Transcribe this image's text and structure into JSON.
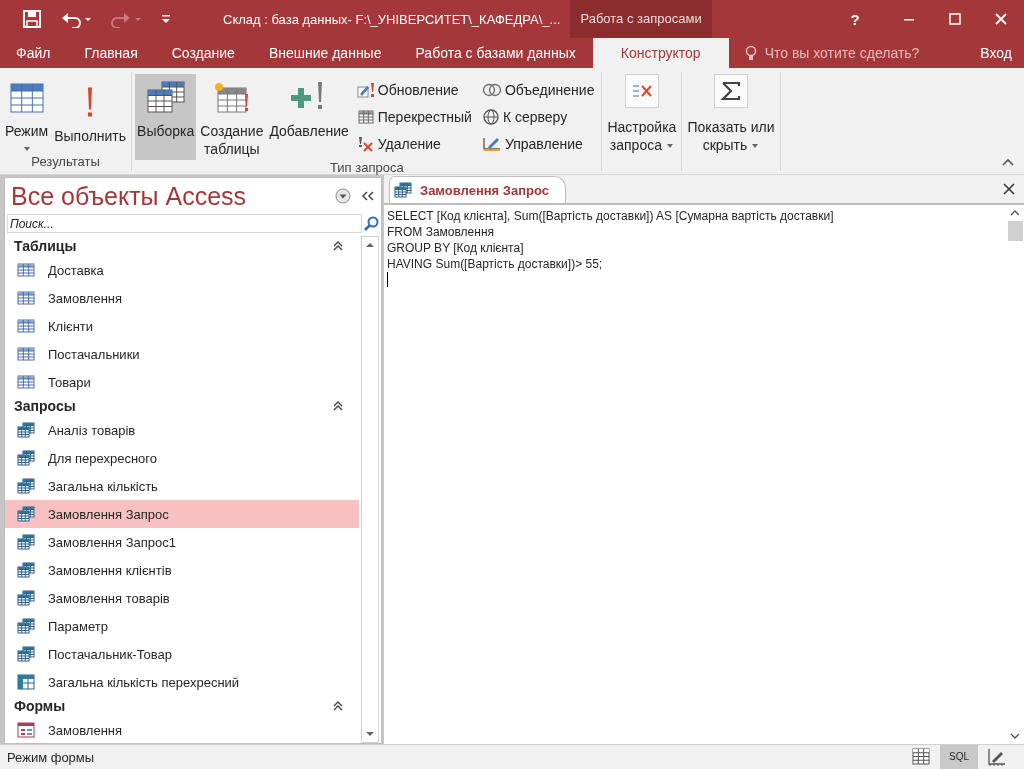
{
  "title_bar": {
    "title": "Склад : база данных- F:\\_УНІВЕРСИТЕТ\\_КАФЕДРА\\_...",
    "contextual_tab": "Работа с запросами",
    "help": "?",
    "redo_disabled": true
  },
  "ribbon_tabs": [
    {
      "label": "Файл",
      "selected": false
    },
    {
      "label": "Главная",
      "selected": false
    },
    {
      "label": "Создание",
      "selected": false
    },
    {
      "label": "Внешние данные",
      "selected": false
    },
    {
      "label": "Работа с базами данных",
      "selected": false
    },
    {
      "label": "Конструктор",
      "selected": true
    }
  ],
  "tell_me": {
    "placeholder": "Что вы хотите сделать?"
  },
  "account": "Вход",
  "ribbon_groups": [
    {
      "label": "Результаты",
      "buttons": [
        {
          "label": "Режим",
          "kind": "large",
          "dropdown": true,
          "selected": false
        },
        {
          "label": "Выполнить",
          "kind": "large",
          "dropdown": false,
          "selected": false
        }
      ]
    },
    {
      "label": "Тип запроса",
      "buttons": [
        {
          "label": "Выборка",
          "kind": "large",
          "dropdown": false,
          "selected": true
        },
        {
          "label": "Создание\nтаблицы",
          "kind": "large",
          "dropdown": false,
          "selected": false
        },
        {
          "label": "Добавление",
          "kind": "large",
          "dropdown": false,
          "selected": false
        },
        {
          "label": "Обновление",
          "kind": "small",
          "dropdown": false,
          "selected": false
        },
        {
          "label": "Перекрестный",
          "kind": "small",
          "dropdown": false,
          "selected": false
        },
        {
          "label": "Удаление",
          "kind": "small",
          "dropdown": false,
          "selected": false
        },
        {
          "label": "Объединение",
          "kind": "small",
          "dropdown": false,
          "selected": false
        },
        {
          "label": "К серверу",
          "kind": "small",
          "dropdown": false,
          "selected": false
        },
        {
          "label": "Управление",
          "kind": "small",
          "dropdown": false,
          "selected": false
        }
      ]
    },
    {
      "buttons": [
        {
          "label": "Настройка\nзапроса",
          "kind": "boxed",
          "dropdown": true,
          "selected": false
        }
      ]
    },
    {
      "buttons": [
        {
          "label": "Показать или\nскрыть",
          "kind": "boxed",
          "dropdown": true,
          "selected": false
        }
      ]
    }
  ],
  "nav_pane": {
    "title": "Все объекты Access",
    "search": {
      "placeholder": "Поиск..."
    },
    "groups": [
      {
        "label": "Таблицы",
        "expanded": true,
        "items": [
          {
            "label": "Доставка",
            "kind": "table",
            "selected": false
          },
          {
            "label": "Замовлення",
            "kind": "table",
            "selected": false
          },
          {
            "label": "Клієнти",
            "kind": "table",
            "selected": false
          },
          {
            "label": "Постачальники",
            "kind": "table",
            "selected": false
          },
          {
            "label": "Товари",
            "kind": "table",
            "selected": false
          }
        ]
      },
      {
        "label": "Запросы",
        "expanded": true,
        "items": [
          {
            "label": "Аналіз товарів",
            "kind": "query",
            "selected": false
          },
          {
            "label": "Для перехресного",
            "kind": "query",
            "selected": false
          },
          {
            "label": "Загальна кількість",
            "kind": "query",
            "selected": false
          },
          {
            "label": "Замовлення Запрос",
            "kind": "query",
            "selected": true
          },
          {
            "label": "Замовлення Запрос1",
            "kind": "query",
            "selected": false
          },
          {
            "label": "Замовлення клієнтів",
            "kind": "query",
            "selected": false
          },
          {
            "label": "Замовлення товарів",
            "kind": "query",
            "selected": false
          },
          {
            "label": "Параметр",
            "kind": "query",
            "selected": false
          },
          {
            "label": "Постачальник-Товар",
            "kind": "query",
            "selected": false
          },
          {
            "label": "Загальна кількість перехресний",
            "kind": "crosstab",
            "selected": false
          }
        ]
      },
      {
        "label": "Формы",
        "expanded": true,
        "items": [
          {
            "label": "Замовлення",
            "kind": "form",
            "selected": false
          }
        ]
      }
    ]
  },
  "document": {
    "tab": {
      "label": "Замовлення Запрос",
      "selected": true
    },
    "sql_lines": [
      "SELECT [Код клієнта], Sum([Вартість доставки]) AS [Сумарна вартість доставки]",
      "FROM Замовлення",
      "GROUP BY [Код клієнта]",
      "HAVING Sum([Вартість доставки])> 55;"
    ]
  },
  "status_bar": {
    "text": "Режим формы",
    "views": [
      {
        "kind": "datasheet",
        "selected": false
      },
      {
        "kind": "sql",
        "label": "SQL",
        "selected": true
      },
      {
        "kind": "design",
        "selected": false
      }
    ]
  }
}
